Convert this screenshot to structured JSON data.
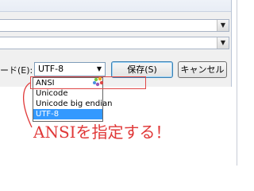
{
  "dialog": {
    "encoding_label": "ード(E):",
    "encoding_value": "UTF-8",
    "save_button": "保存(S)",
    "cancel_button": "キャンセル"
  },
  "dropdown": {
    "options": [
      "ANSI",
      "Unicode",
      "Unicode big endian",
      "UTF-8"
    ],
    "selected": "UTF-8"
  },
  "annotation": {
    "text": "ANSIを指定する！",
    "color": "#e03838"
  },
  "colors": {
    "highlight": "#3399ff",
    "annotation": "#e03838"
  }
}
